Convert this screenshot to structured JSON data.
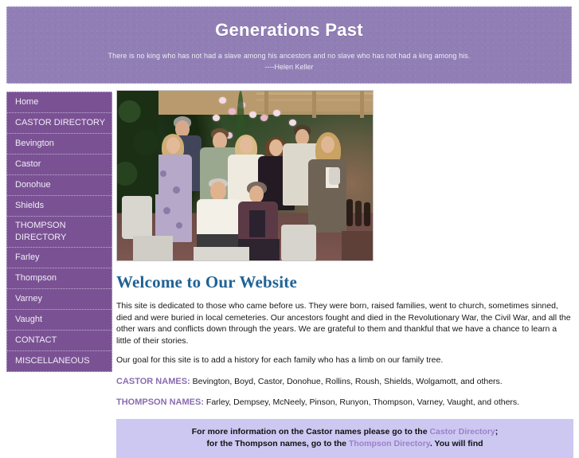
{
  "banner": {
    "title": "Generations Past",
    "quote": "There is no king who has not had a slave among his ancestors and no slave who has not had a king among his.",
    "attribution": "----Helen Keller",
    "background_color": "#907eb5",
    "title_color": "#ffffff"
  },
  "sidebar": {
    "background_color": "#7a5294",
    "text_color": "#f2ecf7",
    "items": [
      {
        "label": "Home",
        "name": "home"
      },
      {
        "label": "CASTOR DIRECTORY",
        "name": "castor-directory"
      },
      {
        "label": "Bevington",
        "name": "bevington"
      },
      {
        "label": "Castor",
        "name": "castor"
      },
      {
        "label": "Donohue",
        "name": "donohue"
      },
      {
        "label": "Shields",
        "name": "shields"
      },
      {
        "label": "THOMPSON DIRECTORY",
        "name": "thompson-directory"
      },
      {
        "label": "Farley",
        "name": "farley"
      },
      {
        "label": "Thompson",
        "name": "thompson"
      },
      {
        "label": "Varney",
        "name": "varney"
      },
      {
        "label": "Vaught",
        "name": "vaught"
      },
      {
        "label": "CONTACT",
        "name": "contact"
      },
      {
        "label": "MISCELLANEOUS",
        "name": "miscellaneous"
      }
    ]
  },
  "main": {
    "photo_alt": "Family group portrait of eleven people posed outdoors on a garden patio",
    "heading": "Welcome to Our Website",
    "heading_color": "#1f6395",
    "paragraph1": "This site is dedicated to those who came before us. They were born, raised families, went to church, sometimes sinned, died and were buried in local cemeteries.  Our ancestors fought and died in the Revolutionary War, the Civil War, and all the other wars and conflicts down through the years.  We are grateful to them and thankful that we have a chance to learn a little of their stories.",
    "paragraph2": "Our goal for this site is to add a history for each family who has a limb on our family tree.",
    "castor_label": "CASTOR NAMES:",
    "castor_names": " Bevington, Boyd, Castor, Donohue, Rollins, Roush, Shields, Wolgamott, and others.",
    "thompson_label": "THOMPSON NAMES:",
    "thompson_names": " Farley, Dempsey, McNeely, Pinson, Runyon, Thompson, Varney, Vaught, and others.",
    "label_color": "#8a6cb0"
  },
  "callout": {
    "background_color": "#ccc8f2",
    "link_color": "#9d80c9",
    "text_before_link1": "For more information on the Castor names please go to the ",
    "link1": "Castor Directory",
    "text_after_link1": ";",
    "text_before_link2": "for the Thompson names, go to the ",
    "link2": "Thompson Directory",
    "text_after_link2": ". You will find"
  }
}
